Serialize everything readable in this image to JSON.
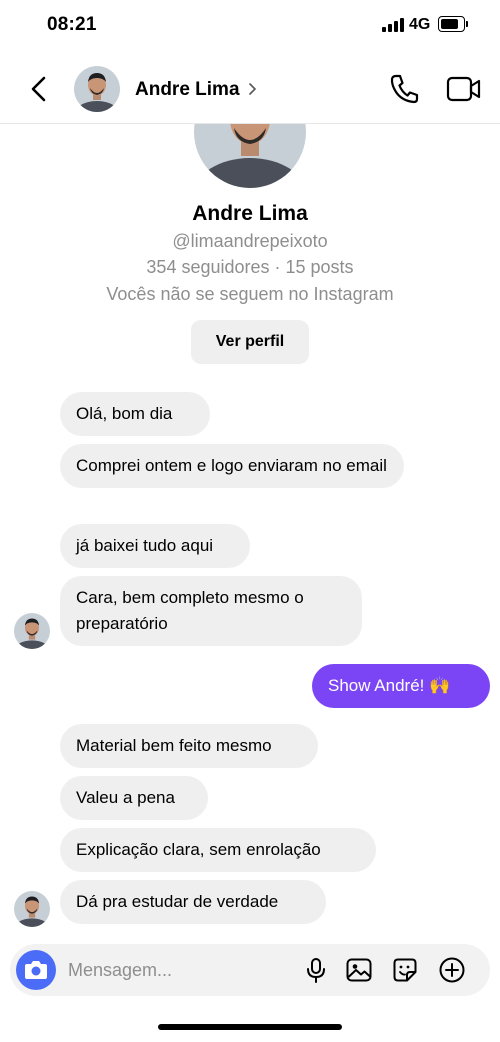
{
  "status_bar": {
    "time": "08:21",
    "network": "4G"
  },
  "header": {
    "name": "Andre Lima",
    "icons": {
      "back": "chevron-left-icon",
      "name_chevron": "chevron-right-icon",
      "call": "phone-icon",
      "video": "video-camera-icon"
    }
  },
  "profile": {
    "name": "Andre Lima",
    "handle": "@limaandrepeixoto",
    "stats": "354 seguidores · 15 posts",
    "note": "Vocês não se seguem no Instagram",
    "view_profile_label": "Ver perfil"
  },
  "messages": [
    {
      "from": "them",
      "text": "Olá, bom dia"
    },
    {
      "from": "them",
      "text": "Comprei ontem e logo enviaram no email"
    },
    {
      "from": "them",
      "text": "já baixei tudo aqui"
    },
    {
      "from": "them",
      "text": "Cara, bem completo mesmo o preparatório",
      "avatar": true
    },
    {
      "from": "me",
      "text": "Show André! 🙌"
    },
    {
      "from": "them",
      "text": "Material bem feito mesmo"
    },
    {
      "from": "them",
      "text": "Valeu a pena"
    },
    {
      "from": "them",
      "text": "Explicação clara, sem enrolação"
    },
    {
      "from": "them",
      "text": "Dá pra estudar de verdade",
      "avatar": true
    }
  ],
  "composer": {
    "placeholder": "Mensagem...",
    "icons": [
      "camera-icon",
      "microphone-icon",
      "image-icon",
      "sticker-icon",
      "plus-circle-icon"
    ]
  },
  "colors": {
    "accent": "#7b45f5",
    "camera_button": "#4b6cf7",
    "incoming_bubble": "#efefef",
    "muted_text": "#8e8e8e"
  }
}
